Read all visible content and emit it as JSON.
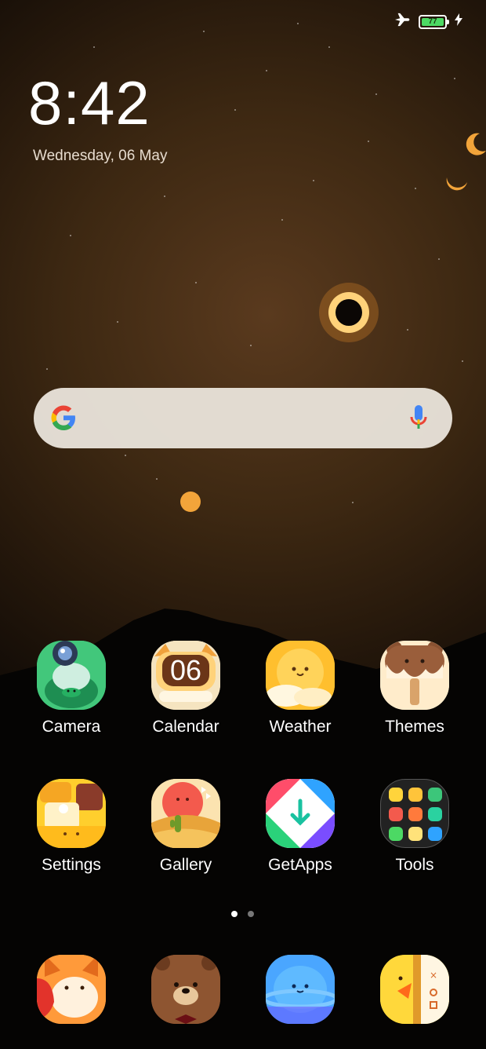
{
  "status": {
    "battery_level": "77",
    "icons": [
      "airplane-icon",
      "battery-icon",
      "charging-icon"
    ]
  },
  "lockclock": {
    "time": "8:42",
    "date": "Wednesday, 06 May"
  },
  "search": {
    "icons": [
      "google-logo-icon",
      "microphone-icon"
    ]
  },
  "apps": [
    {
      "label": "Camera"
    },
    {
      "label": "Calendar",
      "day": "06"
    },
    {
      "label": "Weather"
    },
    {
      "label": "Themes"
    },
    {
      "label": "Settings"
    },
    {
      "label": "Gallery"
    },
    {
      "label": "GetApps"
    },
    {
      "label": "Tools"
    }
  ],
  "pager": {
    "pages": 2,
    "current": 1
  },
  "dock": [
    {
      "icon": "fox-messages-icon"
    },
    {
      "icon": "bear-phone-icon"
    },
    {
      "icon": "planet-browser-icon"
    },
    {
      "icon": "chick-clock-icon"
    }
  ]
}
